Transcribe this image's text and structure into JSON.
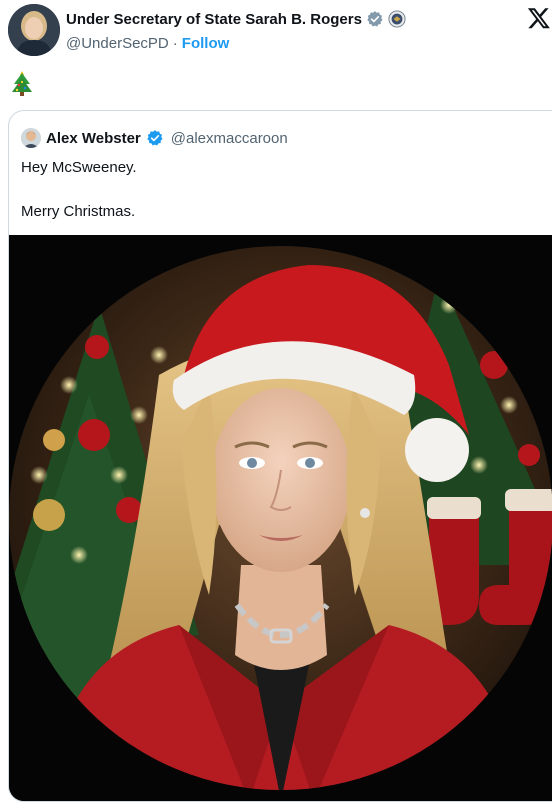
{
  "post": {
    "author_name": "Under Secretary of State Sarah B. Rogers",
    "author_handle": "@UnderSecPD",
    "separator": "·",
    "follow_label": "Follow",
    "verified_badge": "gray-verified-badge-icon",
    "affiliation_badge": "us-state-department-seal-icon",
    "body_emoji": "🎄"
  },
  "quoted": {
    "author_name": "Alex Webster",
    "author_handle": "@alexmaccaroon",
    "verified_badge": "blue-verified-badge-icon",
    "lines": [
      "Hey McSweeney.",
      "Merry Christmas."
    ]
  },
  "colors": {
    "link_blue": "#1d9bf0",
    "muted_gray": "#536471",
    "santa_hat_red": "#c8191e",
    "jacket_red": "#b51c22"
  }
}
